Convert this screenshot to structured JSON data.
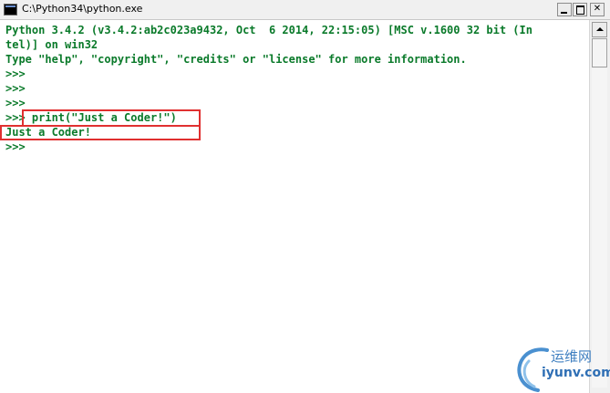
{
  "window": {
    "title": "C:\\Python34\\python.exe",
    "buttons": {
      "minimize": "",
      "maximize": "",
      "close": "✕"
    }
  },
  "console": {
    "lines": [
      "Python 3.4.2 (v3.4.2:ab2c023a9432, Oct  6 2014, 22:15:05) [MSC v.1600 32 bit (In",
      "tel)] on win32",
      "Type \"help\", \"copyright\", \"credits\" or \"license\" for more information.",
      ">>>",
      ">>>",
      ">>>",
      ">>> print(\"Just a Coder!\")",
      "Just a Coder!",
      ">>>"
    ],
    "text_color": "#0a7a2a",
    "highlight_color": "#e03030"
  },
  "watermark": {
    "chinese": "运维网",
    "url": "iyunv.com"
  }
}
